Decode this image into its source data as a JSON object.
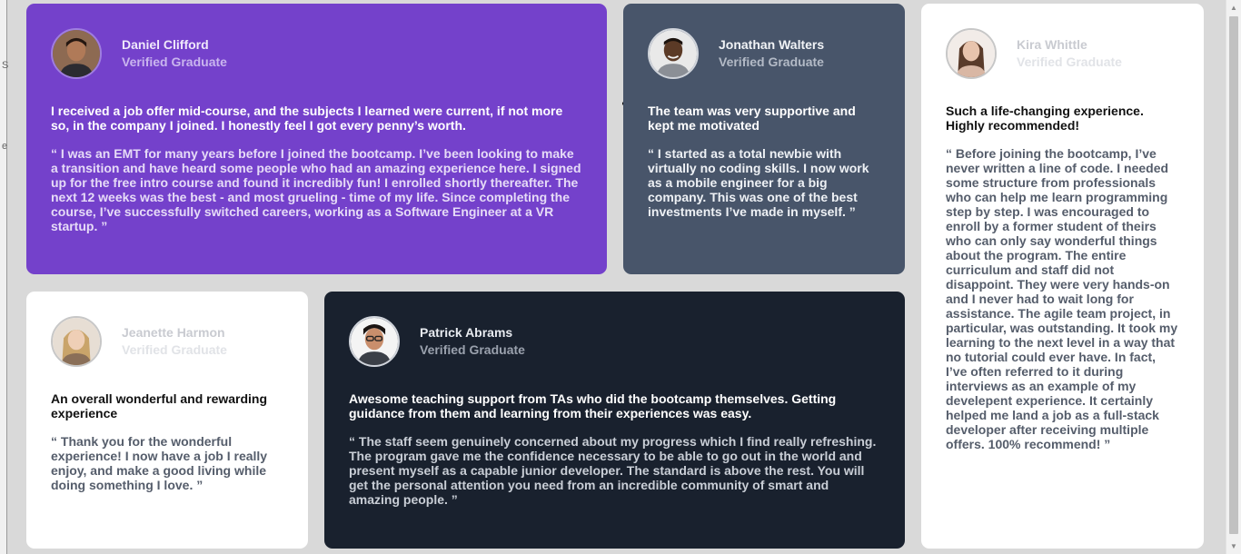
{
  "viewport": {
    "background": "#d9d9d9"
  },
  "left_strip": {
    "fragments": [
      "S",
      "e"
    ]
  },
  "testimonials": [
    {
      "name": "Daniel Clifford",
      "role": "Verified Graduate",
      "headline": "I received a job offer mid-course, and the subjects I learned were current, if not more so, in the company I joined. I honestly feel I got every penny’s worth.",
      "quote": "“ I was an EMT for many years before I joined the bootcamp. I’ve been looking to make a transition and have heard some people who had an amazing experience here. I signed up for the free intro course and found it incredibly fun! I enrolled shortly thereafter. The next 12 weeks was the best - and most grueling - time of my life. Since completing the course, I’ve successfully switched careers, working as a Software Engineer at a VR startup. ”",
      "card_color": "#7441cb"
    },
    {
      "name": "Jonathan Walters",
      "role": "Verified Graduate",
      "headline": "The team was very supportive and kept me motivated",
      "quote": "“ I started as a total newbie with virtually no coding skills. I now work as a mobile engineer for a big company. This was one of the best investments I’ve made in myself. ”",
      "card_color": "#48556a"
    },
    {
      "name": "Kira Whittle",
      "role": "Verified Graduate",
      "headline": "Such a life-changing experience. Highly recommended!",
      "quote": "“ Before joining the bootcamp, I’ve never written a line of code. I needed some structure from professionals who can help me learn programming step by step. I was encouraged to enroll by a former student of theirs who can only say wonderful things about the program. The entire curriculum and staff did not disappoint. They were very hands-on and I never had to wait long for assistance. The agile team project, in particular, was outstanding. It took my learning to the next level in a way that no tutorial could ever have. In fact, I’ve often referred to it during interviews as an example of my develepent experience. It certainly helped me land a job as a full-stack developer after receiving multiple offers. 100% recommend! ”",
      "card_color": "#ffffff"
    },
    {
      "name": "Jeanette Harmon",
      "role": "Verified Graduate",
      "headline": "An overall wonderful and rewarding experience",
      "quote": "“ Thank you for the wonderful experience! I now have a job I really enjoy, and make a good living while doing something I love. ”",
      "card_color": "#ffffff"
    },
    {
      "name": "Patrick Abrams",
      "role": "Verified Graduate",
      "headline": "Awesome teaching support from TAs who did the bootcamp themselves. Getting guidance from them and learning from their experiences was easy.",
      "quote": "“ The staff seem genuinely concerned about my progress which I find really refreshing. The program gave me the confidence necessary to be able to go out in the world and present myself as a capable junior developer. The standard is above the rest. You will get the personal attention you need from an incredible community of smart and amazing people. ”",
      "card_color": "#19212e"
    }
  ],
  "icons": {
    "avatar": "user-avatar-icon",
    "scroll_up": "scroll-up-arrow-icon",
    "scroll_down": "scroll-down-arrow-icon"
  }
}
